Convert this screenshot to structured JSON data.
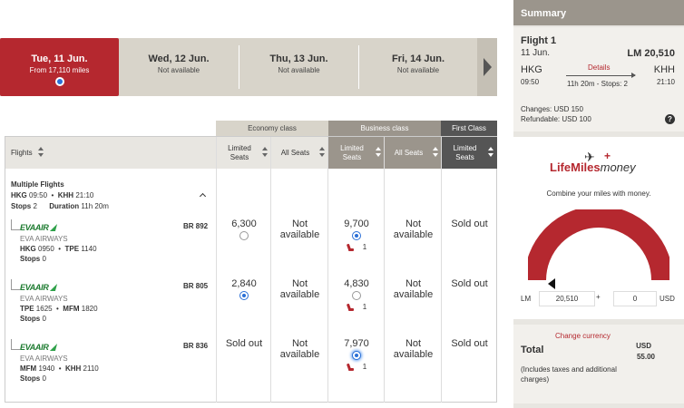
{
  "dates": [
    {
      "label": "Tue, 11 Jun.",
      "sub": "From 17,110 miles",
      "selected": true
    },
    {
      "label": "Wed, 12 Jun.",
      "sub": "Not available",
      "selected": false
    },
    {
      "label": "Thu, 13 Jun.",
      "sub": "Not available",
      "selected": false
    },
    {
      "label": "Fri, 14 Jun.",
      "sub": "Not available",
      "selected": false
    }
  ],
  "class_tabs": {
    "economy": "Economy class",
    "business": "Business class",
    "first": "First Class"
  },
  "columns": {
    "flights": "Flights",
    "econ_limited": "Limited Seats",
    "econ_all": "All Seats",
    "bus_limited": "Limited Seats",
    "bus_all": "All Seats",
    "first_limited": "Limited Seats"
  },
  "itinerary": {
    "title": "Multiple Flights",
    "from": "HKG",
    "dep": "09:50",
    "to": "KHH",
    "arr": "21:10",
    "stops_label": "Stops",
    "stops": "2",
    "duration_label": "Duration",
    "duration": "11h 20m"
  },
  "segments": [
    {
      "logo": "EVAAIR",
      "airline": "EVA AIRWAYS",
      "from": "HKG",
      "dep": "0950",
      "to": "TPE",
      "arr": "1140",
      "stops_label": "Stops",
      "stops": "0",
      "flight_no": "BR 892",
      "econ_limited": "6,300",
      "econ_limited_radio": "off",
      "econ_all": "Not available",
      "bus_limited": "9,700",
      "bus_limited_radio": "on",
      "bus_seats": "1",
      "bus_all": "Not available",
      "first": "Sold out"
    },
    {
      "logo": "EVAAIR",
      "airline": "EVA AIRWAYS",
      "from": "TPE",
      "dep": "1625",
      "to": "MFM",
      "arr": "1820",
      "stops_label": "Stops",
      "stops": "0",
      "flight_no": "BR 805",
      "econ_limited": "2,840",
      "econ_limited_radio": "on",
      "econ_all": "Not available",
      "bus_limited": "4,830",
      "bus_limited_radio": "off",
      "bus_seats": "1",
      "bus_all": "Not available",
      "first": "Sold out"
    },
    {
      "logo": "EVAAIR",
      "airline": "EVA AIRWAYS",
      "from": "MFM",
      "dep": "1940",
      "to": "KHH",
      "arr": "2110",
      "stops_label": "Stops",
      "stops": "0",
      "flight_no": "BR 836",
      "econ_limited": "Sold out",
      "econ_all": "Not available",
      "bus_limited": "7,970",
      "bus_limited_radio": "on",
      "bus_seats": "1",
      "bus_all": "Not available",
      "first": "Sold out"
    }
  ],
  "summary": {
    "header": "Summary",
    "flight_title": "Flight 1",
    "date": "11 Jun.",
    "price": "LM 20,510",
    "from": "HKG",
    "dep": "09:50",
    "to": "KHH",
    "arr": "21:10",
    "details_link": "Details",
    "duration_stops": "11h 20m - Stops: 2",
    "changes": "Changes: USD 150",
    "refundable": "Refundable: USD 100",
    "help": "?"
  },
  "lifemiles": {
    "logo_brand": "LifeMiles",
    "logo_money": "money",
    "tagline": "Combine your miles with money.",
    "gauge_fraction": 1.0,
    "lm_label": "LM",
    "lm_value": "20,510",
    "plus": "+",
    "usd_value": "0",
    "usd_label": "USD"
  },
  "total": {
    "change_currency": "Change currency",
    "label": "Total",
    "currency": "USD",
    "amount": "55.00",
    "note": "(Includes taxes and additional charges)"
  },
  "colors": {
    "brand_red": "#b5282f",
    "business_header": "#9b958c",
    "first_header": "#555555",
    "economy_header": "#d8d4ca",
    "radio_selected": "#2a6fd6",
    "eva_green": "#1b7a2e"
  }
}
